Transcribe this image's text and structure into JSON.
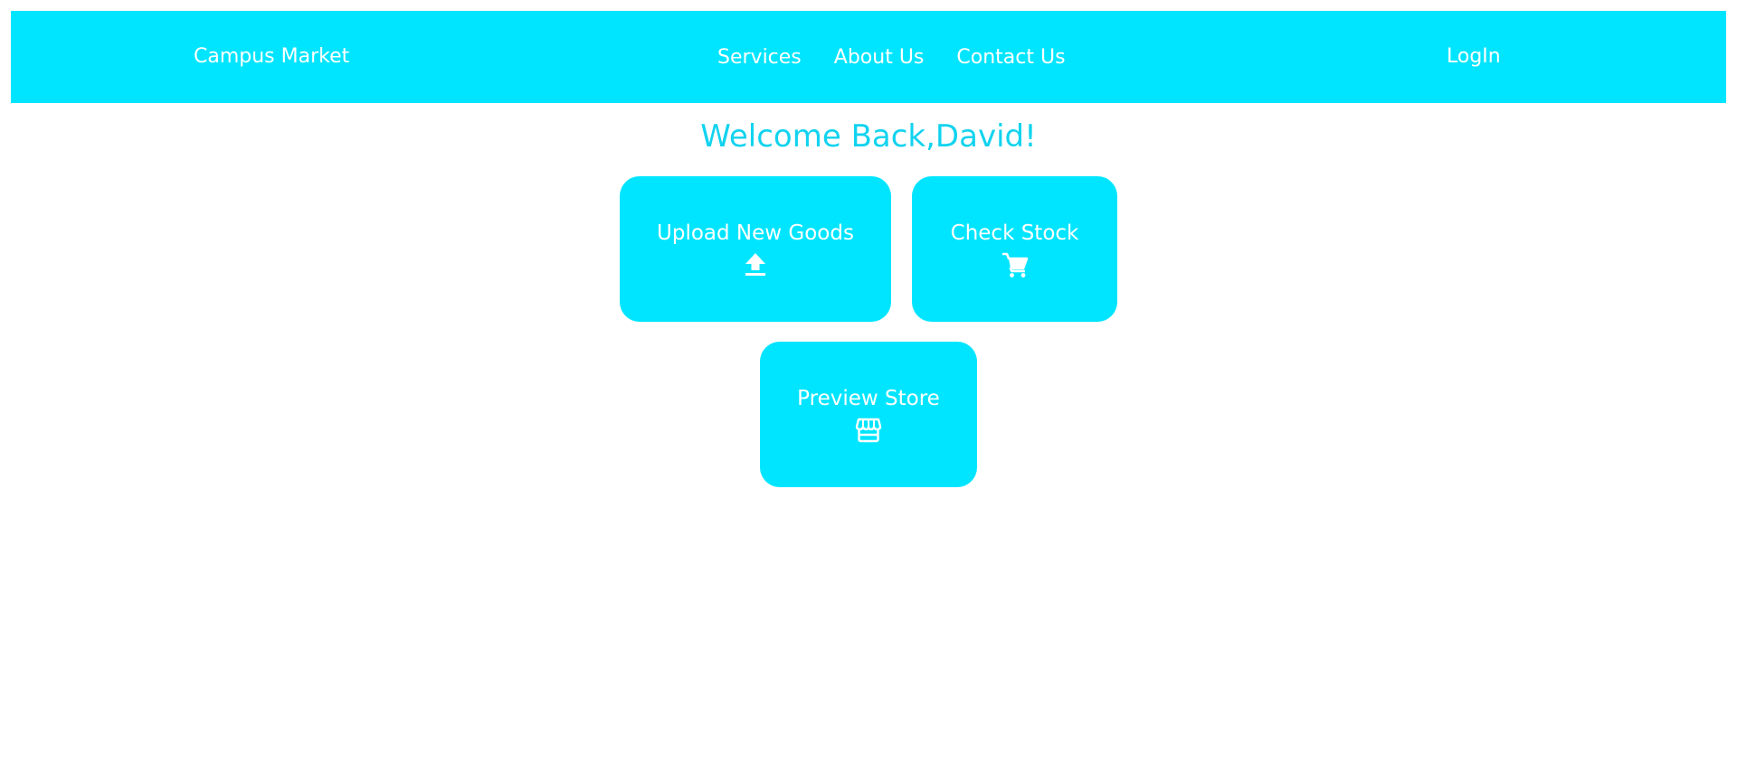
{
  "header": {
    "brand": "Campus Market",
    "nav": [
      {
        "label": "Services"
      },
      {
        "label": "About Us"
      },
      {
        "label": "Contact Us"
      }
    ],
    "login": "LogIn",
    "background_color": "#00e5ff"
  },
  "main": {
    "welcome": "Welcome Back,David!",
    "welcome_color": "#11d3ef",
    "tiles": [
      {
        "label": "Upload New Goods",
        "icon": "upload-icon"
      },
      {
        "label": "Check Stock",
        "icon": "shopping-cart-icon"
      },
      {
        "label": "Preview Store",
        "icon": "storefront-icon"
      }
    ],
    "tile_color": "#00e5ff"
  }
}
